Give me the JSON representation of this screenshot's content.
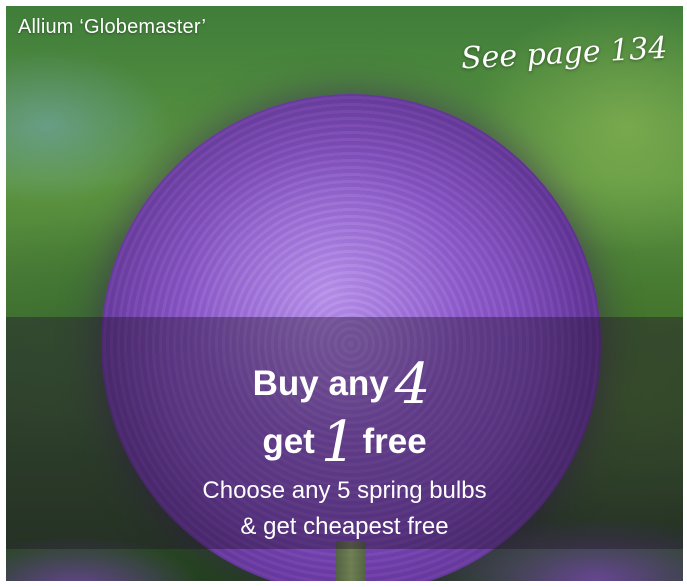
{
  "photo": {
    "caption": "Allium ‘Globemaster’",
    "see_page": "See page 134"
  },
  "offer": {
    "line1_prefix": "Buy any",
    "line1_number": "4",
    "line2_prefix": "get",
    "line2_number": "1",
    "line2_suffix": "free",
    "sub1": "Choose any 5 spring bulbs",
    "sub2": "& get cheapest free"
  },
  "colors": {
    "flower": "#7a48b6",
    "text": "#ffffff",
    "overlay": "#23142d"
  }
}
